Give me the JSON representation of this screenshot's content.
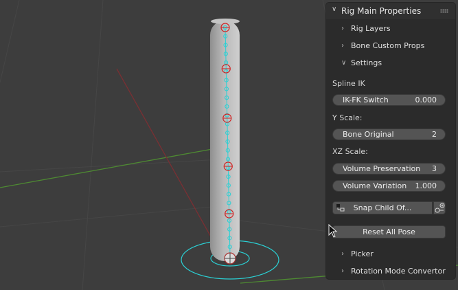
{
  "panel": {
    "title": "Rig Main Properties",
    "subpanels": [
      {
        "label": "Rig Layers"
      },
      {
        "label": "Bone Custom Props"
      },
      {
        "label": "Settings"
      }
    ],
    "spline_ik_label": "Spline IK",
    "ik_fk_switch": {
      "label": "IK-FK Switch",
      "value": "0.000"
    },
    "y_scale_label": "Y Scale:",
    "bone_original": {
      "label": "Bone Original",
      "value": "2"
    },
    "xz_scale_label": "XZ Scale:",
    "volume_preservation": {
      "label": "Volume Preservation",
      "value": "3"
    },
    "volume_variation": {
      "label": "Volume Variation",
      "value": "1.000"
    },
    "snap_child_label": "Snap Child Of...",
    "reset_label": "Reset All Pose",
    "bottom_subpanels": [
      {
        "label": "Picker"
      },
      {
        "label": "Rotation Mode Convertor"
      }
    ]
  },
  "colors": {
    "viewport_bg": "#3d3d3d",
    "panel_bg": "#2b2b2b",
    "field_bg": "#545454",
    "bone_cyan": "#2bd0d4",
    "control_red": "#d02020"
  }
}
